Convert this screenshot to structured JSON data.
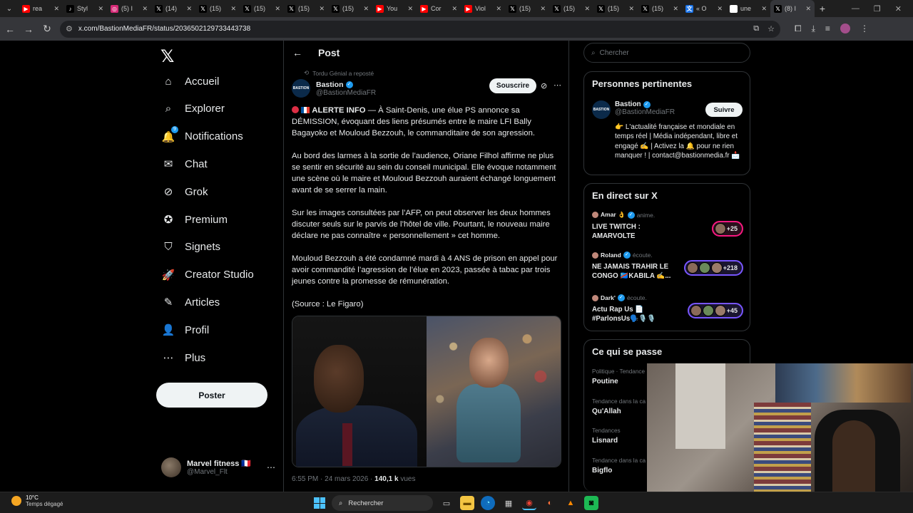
{
  "browser": {
    "tabs": [
      {
        "title": "rea",
        "icon": "youtube-icon",
        "color": "#ff0000",
        "glyph": "▶"
      },
      {
        "title": "Styl",
        "icon": "tiktok-icon",
        "color": "#000000",
        "glyph": "♪"
      },
      {
        "title": "(5) I",
        "icon": "instagram-icon",
        "color": "#d62976",
        "glyph": "◎"
      },
      {
        "title": "(14)",
        "icon": "x-icon",
        "color": "#000000",
        "glyph": "𝕏"
      },
      {
        "title": "(15)",
        "icon": "x-icon",
        "color": "#000000",
        "glyph": "𝕏"
      },
      {
        "title": "(15)",
        "icon": "x-icon",
        "color": "#000000",
        "glyph": "𝕏"
      },
      {
        "title": "(15)",
        "icon": "x-icon",
        "color": "#000000",
        "glyph": "𝕏"
      },
      {
        "title": "(15)",
        "icon": "x-icon",
        "color": "#000000",
        "glyph": "𝕏"
      },
      {
        "title": "You",
        "icon": "youtube-icon",
        "color": "#ff0000",
        "glyph": "▶"
      },
      {
        "title": "Cor",
        "icon": "youtube-icon",
        "color": "#ff0000",
        "glyph": "▶"
      },
      {
        "title": "Viol",
        "icon": "youtube-icon",
        "color": "#ff0000",
        "glyph": "▶"
      },
      {
        "title": "(15)",
        "icon": "x-icon",
        "color": "#000000",
        "glyph": "𝕏"
      },
      {
        "title": "(15)",
        "icon": "x-icon",
        "color": "#000000",
        "glyph": "𝕏"
      },
      {
        "title": "(15)",
        "icon": "x-icon",
        "color": "#000000",
        "glyph": "𝕏"
      },
      {
        "title": "(15)",
        "icon": "x-icon",
        "color": "#000000",
        "glyph": "𝕏"
      },
      {
        "title": "« O",
        "icon": "translate-icon",
        "color": "#1a73e8",
        "glyph": "文"
      },
      {
        "title": "une",
        "icon": "page-icon",
        "color": "#ffffff",
        "glyph": ""
      },
      {
        "title": "(8) I",
        "icon": "x-icon",
        "color": "#000000",
        "glyph": "𝕏",
        "active": true
      }
    ],
    "url": "x.com/BastionMediaFR/status/2036502129733443738"
  },
  "nav": {
    "logo": "𝕏",
    "items": [
      {
        "label": "Accueil",
        "icon": "home-icon",
        "glyph": "⌂"
      },
      {
        "label": "Explorer",
        "icon": "search-icon",
        "glyph": "⌕"
      },
      {
        "label": "Notifications",
        "icon": "bell-icon",
        "glyph": "🔔",
        "badge": "9"
      },
      {
        "label": "Chat",
        "icon": "mail-icon",
        "glyph": "✉"
      },
      {
        "label": "Grok",
        "icon": "grok-icon",
        "glyph": "⊘"
      },
      {
        "label": "Premium",
        "icon": "premium-icon",
        "glyph": "✪"
      },
      {
        "label": "Signets",
        "icon": "bookmark-icon",
        "glyph": "⛉"
      },
      {
        "label": "Creator Studio",
        "icon": "rocket-icon",
        "glyph": "🚀"
      },
      {
        "label": "Articles",
        "icon": "article-icon",
        "glyph": "✎"
      },
      {
        "label": "Profil",
        "icon": "profile-icon",
        "glyph": "👤"
      },
      {
        "label": "Plus",
        "icon": "more-circle-icon",
        "glyph": "⋯"
      }
    ],
    "post_button": "Poster",
    "account": {
      "name": "Marvel fitness 🇫🇷",
      "handle": "@Marvel_Flt"
    }
  },
  "post": {
    "header": "Post",
    "repost_by": "Tordu Génial a reposté",
    "author_name": "Bastion",
    "author_handle": "@BastionMediaFR",
    "avatar_text": "BASTION",
    "subscribe_label": "Souscrire",
    "paragraphs": [
      {
        "lead": "ALERTE INFO",
        "text": " — À Saint-Denis, une élue PS annonce sa DÉMISSION, évoquant des liens présumés entre le maire LFI Bally Bagayoko et Mouloud Bezzouh, le commanditaire de son agression."
      },
      {
        "text": "Au bord des larmes à la sortie de l’audience, Oriane Filhol affirme ne plus se sentir en sécurité au sein du conseil municipal. Elle évoque notamment une scène où le maire et Mouloud Bezzouh auraient échangé longuement avant de se serrer la main."
      },
      {
        "text": "Sur les images consultées par l’AFP, on peut observer les deux hommes discuter seuls sur le parvis de l’hôtel de ville. Pourtant, le nouveau maire déclare ne pas connaître « personnellement » cet homme."
      },
      {
        "text": "Mouloud Bezzouh a été condamné mardi à 4 ANS de prison en appel pour avoir commandité l’agression de l’élue en 2023, passée à tabac par trois jeunes contre la promesse de rémunération."
      },
      {
        "text": "(Source : Le Figaro)"
      }
    ],
    "time": "6:55 PM · 24 mars 2026 · ",
    "views_count": "140,1 k",
    "views_label": " vues"
  },
  "right": {
    "search_placeholder": "Chercher",
    "relevant": {
      "title": "Personnes pertinentes",
      "name": "Bastion",
      "handle": "@BastionMediaFR",
      "follow_label": "Suivre",
      "bio": "👉 L'actualité française et mondiale en temps réel | Média indépendant, libre et engagé ✍️ | Activez la 🔔 pour ne rien manquer ! | contact@bastionmedia.fr 📩"
    },
    "live": {
      "title": "En direct sur X",
      "items": [
        {
          "user": "Amar 👌",
          "action": "anime.",
          "text": "LIVE TWITCH : AMARVOLTE",
          "count": "+25",
          "style": "red"
        },
        {
          "user": "Roland",
          "action": "écoute.",
          "text": "NE JAMAIS TRAHIR LE CONGO 🇨🇩KABILA ✍️...",
          "count": "+218",
          "style": "purple"
        },
        {
          "user": "Dark'",
          "action": "écoute.",
          "text": "Actu Rap Us 📄 #ParlonsUs🗣️🎙️🎙️",
          "count": "+45",
          "style": "purple"
        }
      ]
    },
    "trends": {
      "title": "Ce qui se passe",
      "items": [
        {
          "category": "Politique · Tendance",
          "name": "Poutine"
        },
        {
          "category": "Tendance dans la ca",
          "name": "Qu'Allah"
        },
        {
          "category": "Tendances",
          "name": "Lisnard"
        },
        {
          "category": "Tendance dans la ca",
          "name": "Bigflo"
        }
      ]
    }
  },
  "taskbar": {
    "temp": "10°C",
    "weather": "Temps dégagé",
    "search": "Rechercher"
  },
  "colors": {
    "accent": "#1d9bf0",
    "background": "#000000",
    "border": "#2f3336",
    "muted": "#71767b"
  }
}
